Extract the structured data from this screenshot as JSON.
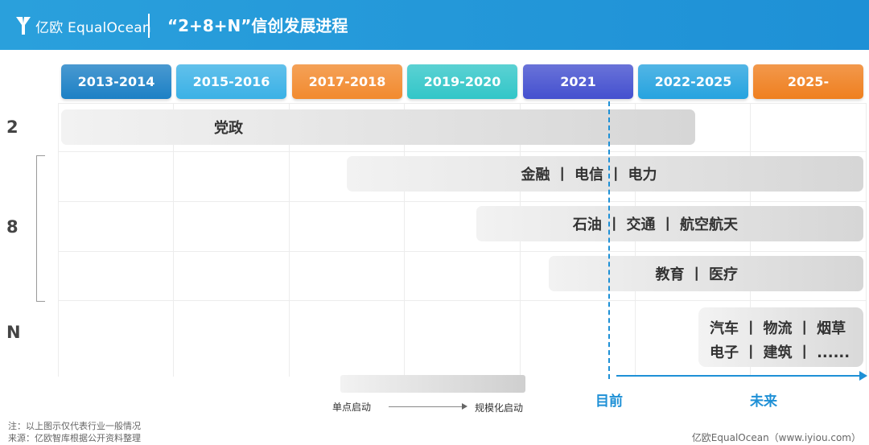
{
  "header": {
    "logo_text": "亿欧 EqualOcean",
    "title": "“2+8+N”信创发展进程",
    "background_color": "#1e90d6"
  },
  "chart_data": {
    "type": "timeline",
    "title": "“2+8+N”信创发展进程",
    "periods": [
      {
        "label": "2013-2014",
        "color": "#1c80c5"
      },
      {
        "label": "2015-2016",
        "color": "#3ab1e6"
      },
      {
        "label": "2017-2018",
        "color": "#f28a2e"
      },
      {
        "label": "2019-2020",
        "color": "#32c6c8"
      },
      {
        "label": "2021",
        "color": "#4450cf"
      },
      {
        "label": "2022-2025",
        "color": "#26a3df"
      },
      {
        "label": "2025-",
        "color": "#ef7f1f"
      }
    ],
    "rows": [
      {
        "label": "2"
      },
      {
        "label": "8"
      },
      {
        "label": "N"
      }
    ],
    "bars": [
      {
        "group": "2",
        "label": "党政",
        "start_period": "2013-2014",
        "end_period": "2022-2025"
      },
      {
        "group": "8",
        "label": "金融 丨 电信 丨 电力",
        "start_period": "2017-2018",
        "end_period": "2025-"
      },
      {
        "group": "8",
        "label": "石油 丨 交通 丨 航空航天",
        "start_period": "2019-2020",
        "end_period": "2025-"
      },
      {
        "group": "8",
        "label": "教育 丨 医疗",
        "start_period": "2021",
        "end_period": "2025-"
      },
      {
        "group": "N",
        "label_lines": [
          "汽车 丨 物流 丨 烟草",
          "电子 丨 建筑 丨 ......"
        ],
        "start_period": "2025-",
        "end_period": "2025-"
      }
    ],
    "current_marker": {
      "period": "2021",
      "label": "目前"
    },
    "future_marker": {
      "label": "未来"
    },
    "legend": {
      "start": "单点启动",
      "end": "规模化启动"
    }
  },
  "notes": {
    "note": "注：以上图示仅代表行业一般情况",
    "source": "来源：亿欧智库根据公开资料整理",
    "credit": "亿欧EqualOcean（www.iyiou.com）"
  }
}
